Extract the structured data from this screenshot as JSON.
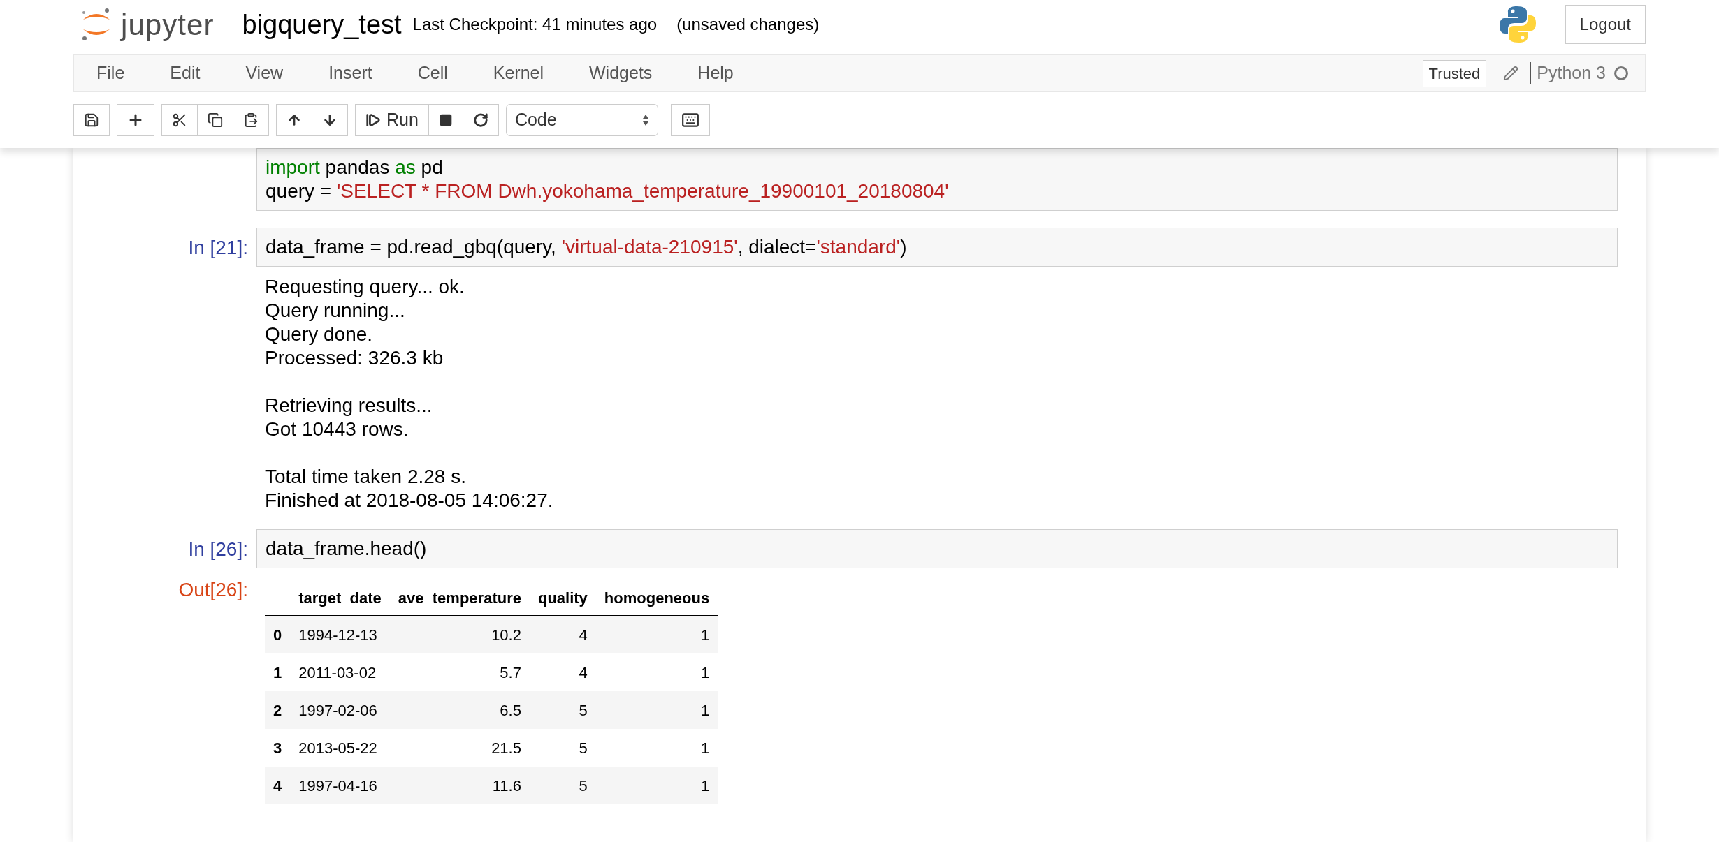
{
  "header": {
    "logo_text": "jupyter",
    "notebook_name": "bigquery_test",
    "checkpoint": "Last Checkpoint: 41 minutes ago",
    "save_status": "(unsaved changes)",
    "logout": "Logout"
  },
  "menu": [
    "File",
    "Edit",
    "View",
    "Insert",
    "Cell",
    "Kernel",
    "Widgets",
    "Help"
  ],
  "trusted": "Trusted",
  "kernel_name": "Python 3",
  "kernel_busy": false,
  "toolbar": {
    "run_label": "Run",
    "cell_type": "Code"
  },
  "cells": [
    {
      "input": [
        [
          {
            "kind": "keyword",
            "text": "import"
          },
          {
            "kind": "plain",
            "text": " pandas "
          },
          {
            "kind": "keyword",
            "text": "as"
          },
          {
            "kind": "plain",
            "text": " pd"
          }
        ],
        [
          {
            "kind": "plain",
            "text": "query = "
          },
          {
            "kind": "string",
            "text": "'SELECT * FROM Dwh.yokohama_temperature_19900101_20180804'"
          }
        ]
      ]
    },
    {
      "prompt": "In [21]:",
      "input": [
        [
          {
            "kind": "plain",
            "text": "data_frame = pd.read_gbq(query, "
          },
          {
            "kind": "string",
            "text": "'virtual-data-210915'"
          },
          {
            "kind": "plain",
            "text": ", dialect="
          },
          {
            "kind": "string",
            "text": "'standard'"
          },
          {
            "kind": "plain",
            "text": ")"
          }
        ]
      ],
      "stream": [
        [
          "Requesting query... ok.",
          "Query running...",
          "Query done.",
          "Processed: 326.3 kb"
        ],
        [
          "Retrieving results...",
          "Got 10443 rows."
        ],
        [
          "Total time taken 2.28 s.",
          "Finished at 2018-08-05 14:06:27."
        ]
      ]
    },
    {
      "prompt": "In [26]:",
      "input": [
        [
          {
            "kind": "plain",
            "text": "data_frame.head()"
          }
        ]
      ],
      "out_prompt": "Out[26]:",
      "table": {
        "columns": [
          "target_date",
          "ave_temperature",
          "quality",
          "homogeneous"
        ],
        "rows": [
          {
            "index": "0",
            "cells": [
              "1994-12-13",
              "10.2",
              "4",
              "1"
            ]
          },
          {
            "index": "1",
            "cells": [
              "2011-03-02",
              "5.7",
              "4",
              "1"
            ]
          },
          {
            "index": "2",
            "cells": [
              "1997-02-06",
              "6.5",
              "5",
              "1"
            ]
          },
          {
            "index": "3",
            "cells": [
              "2013-05-22",
              "21.5",
              "5",
              "1"
            ]
          },
          {
            "index": "4",
            "cells": [
              "1997-04-16",
              "11.6",
              "5",
              "1"
            ]
          }
        ]
      }
    }
  ]
}
